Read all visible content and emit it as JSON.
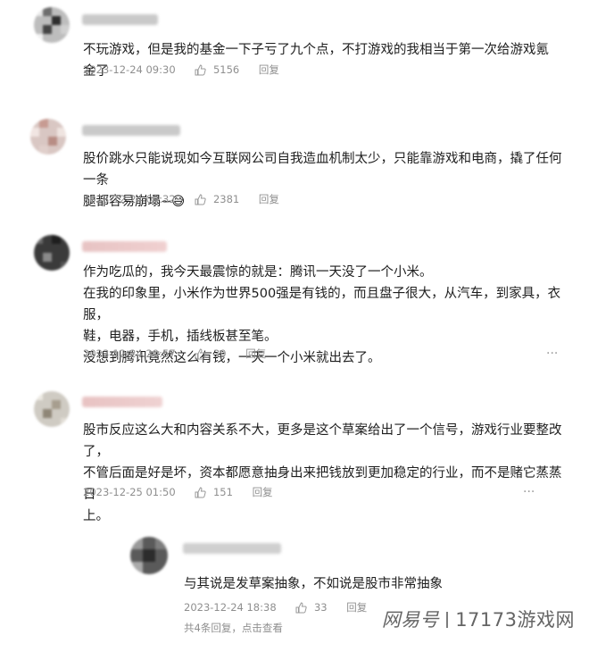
{
  "comments": [
    {
      "text_lines": [
        "不玩游戏，但是我的基金一下子亏了九个点，不打游戏的我相当于第一次给游戏氪金了"
      ],
      "time": "2023-12-24 09:30",
      "likes": "5156",
      "reply_label": "回复"
    },
    {
      "text_lines": [
        "股价跳水只能说现如今互联网公司自我造血机制太少，只能靠游戏和电商，撬了任何一条",
        "腿都容易崩塌~😅"
      ],
      "time": "2023-12-24 09:32",
      "likes": "2381",
      "reply_label": "回复"
    },
    {
      "text_lines": [
        "作为吃瓜的，我今天最震惊的就是：腾讯一天没了一个小米。",
        "在我的印象里，小米作为世界500强是有钱的，而且盘子很大，从汽车，到家具，衣服，",
        "鞋，电器，手机，插线板甚至笔。",
        "没想到腾讯竟然这么有钱，一天一个小米就出去了。"
      ],
      "time": "2023-12-24 20:57",
      "likes": "39",
      "reply_label": "回复"
    },
    {
      "text_lines": [
        "股市反应这么大和内容关系不大，更多是这个草案给出了一个信号，游戏行业要整改了，",
        "不管后面是好是坏，资本都愿意抽身出来把钱放到更加稳定的行业，而不是赌它蒸蒸日",
        "上。"
      ],
      "time": "2023-12-25 01:50",
      "likes": "151",
      "reply_label": "回复"
    }
  ],
  "sub_comment": {
    "text": "与其说是发草案抽象，不如说是股市非常抽象",
    "time": "2023-12-24 18:38",
    "likes": "33",
    "reply_label": "回复",
    "footer": "共4条回复，点击查看"
  },
  "watermark": {
    "logo": "网易号",
    "text": "17173游戏网"
  },
  "icons": {
    "like": "thumb-up-icon",
    "more": "more-dots-icon"
  },
  "colors": {
    "meta_text": "#8f8f8f",
    "body_text": "#1e1e1e"
  }
}
